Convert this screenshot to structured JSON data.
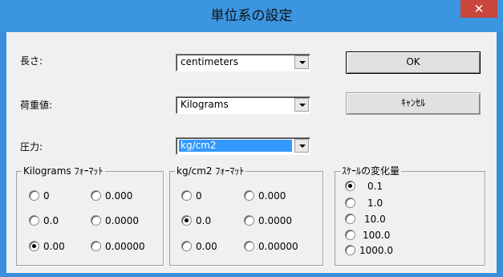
{
  "window": {
    "title": "単位系の設定",
    "close_glyph": "✕"
  },
  "length": {
    "label": "長さ:",
    "value": "centimeters"
  },
  "load": {
    "label": "荷重値:",
    "value": "Kilograms"
  },
  "pressure": {
    "label": "圧力:",
    "value": "kg/cm2"
  },
  "buttons": {
    "ok": "OK",
    "cancel": "ｷｬﾝｾﾙ"
  },
  "kg_format": {
    "legend": "Kilograms ﾌｫｰﾏｯﾄ",
    "options": [
      "0",
      "0.000",
      "0.0",
      "0.0000",
      "0.00",
      "0.00000"
    ],
    "selected": "0.00"
  },
  "pressure_format": {
    "legend": "kg/cm2 ﾌｫｰﾏｯﾄ",
    "options": [
      "0",
      "0.000",
      "0.0",
      "0.0000",
      "0.00",
      "0.00000"
    ],
    "selected": "0.0"
  },
  "scale": {
    "legend": "ｽｹｰﾙの変化量",
    "options": [
      "0.1",
      "1.0",
      "10.0",
      "100.0",
      "1000.0"
    ],
    "selected": "0.1"
  }
}
